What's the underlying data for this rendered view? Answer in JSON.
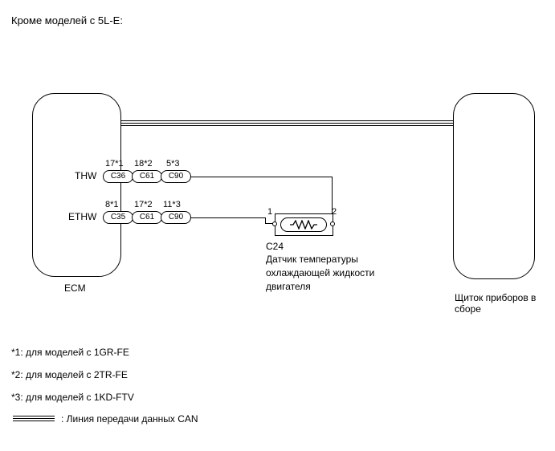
{
  "title": "Кроме моделей с 5L-E:",
  "ecm_label": "ECM",
  "cluster_label": "Щиток приборов в сборе",
  "thw_label": "THW",
  "ethw_label": "ETHW",
  "thw": {
    "p1": {
      "top": "17*1",
      "conn": "C36"
    },
    "p2": {
      "top": "18*2",
      "conn": "C61"
    },
    "p3": {
      "top": "5*3",
      "conn": "C90"
    }
  },
  "ethw": {
    "p1": {
      "top": "8*1",
      "conn": "C35"
    },
    "p2": {
      "top": "17*2",
      "conn": "C61"
    },
    "p3": {
      "top": "11*3",
      "conn": "C90"
    }
  },
  "sensor": {
    "ref": "C24",
    "name": "Датчик температуры охлаждающей жидкости двигателя",
    "pin_left": "1",
    "pin_right": "2"
  },
  "legend": {
    "n1": "*1: для моделей с 1GR-FE",
    "n2": "*2: для моделей с 2TR-FE",
    "n3": "*3: для моделей с 1KD-FTV",
    "bus": ": Линия передачи данных CAN"
  }
}
